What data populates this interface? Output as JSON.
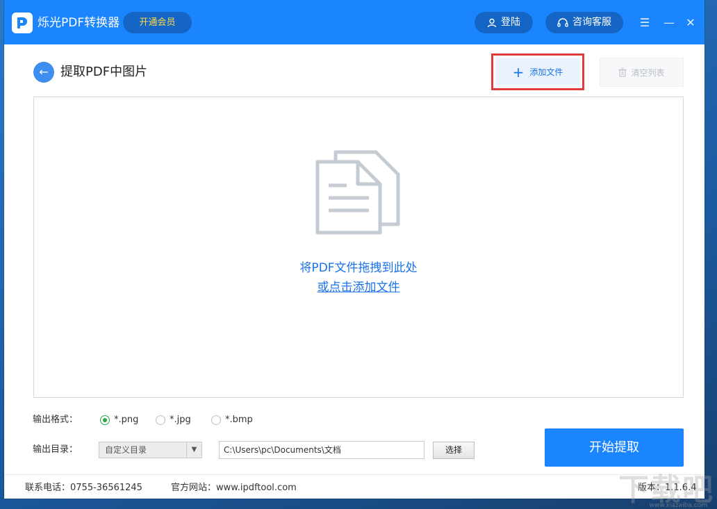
{
  "titlebar": {
    "app_title": "烁光PDF转换器",
    "vip_label": "开通会员",
    "login_label": "登陆",
    "support_label": "咨询客服",
    "controls": [
      "menu-icon",
      "minimize-icon",
      "close-icon"
    ]
  },
  "header": {
    "page_title": "提取PDF中图片",
    "add_file_label": "添加文件",
    "clear_list_label": "清空列表"
  },
  "dropzone": {
    "main_text": "将PDF文件拖拽到此处",
    "link_text": "或点击添加文件"
  },
  "options": {
    "format_label": "输出格式：",
    "formats": [
      {
        "label": "*.png",
        "selected": true
      },
      {
        "label": "*.jpg",
        "selected": false
      },
      {
        "label": "*.bmp",
        "selected": false
      }
    ],
    "dir_label": "输出目录：",
    "dir_mode": "自定义目录",
    "dir_path": "C:\\Users\\pc\\Documents\\文档",
    "choose_label": "选择",
    "start_label": "开始提取"
  },
  "footer": {
    "phone": "联系电话：0755-36561245",
    "website": "官方网站：www.ipdftool.com",
    "version": "版本：1.1.6.4"
  },
  "watermark": {
    "main": "下载吧",
    "sub": "www.xiazaiba.com"
  },
  "colors": {
    "brand_blue": "#1a85ff",
    "link_blue": "#1a72e8",
    "highlight_red": "#e23b3b",
    "vip_yellow": "#ffd84a",
    "radio_green": "#27a844"
  }
}
